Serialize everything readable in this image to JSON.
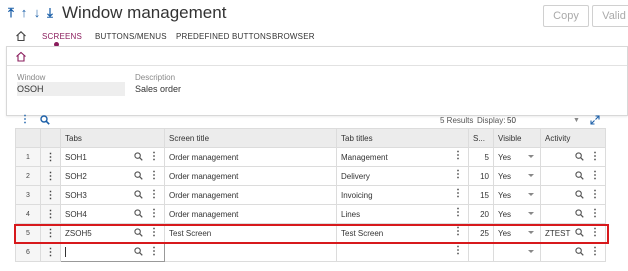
{
  "header": {
    "title": "Window management",
    "buttons": {
      "copy": "Copy",
      "valid": "Valid"
    }
  },
  "tabs": [
    {
      "label": "SCREENS",
      "active": true
    },
    {
      "label": "BUTTONS/MENUS",
      "active": false
    },
    {
      "label": "PREDEFINED BUTTONS",
      "active": false
    },
    {
      "label": "BROWSER",
      "active": false
    }
  ],
  "form": {
    "window_label": "Window",
    "window_value": "OSOH",
    "description_label": "Description",
    "description_value": "Sales order"
  },
  "grid_tools": {
    "results": "5 Results",
    "display_label": "Display:",
    "display_value": "50"
  },
  "grid": {
    "columns": [
      "Tabs",
      "Screen title",
      "Tab titles",
      "S...",
      "Visible",
      "Activity"
    ],
    "rows": [
      {
        "n": "1",
        "tab": "SOH1",
        "screen_title": "Order management",
        "tab_title": "Management",
        "s": "5",
        "visible": "Yes",
        "activity": ""
      },
      {
        "n": "2",
        "tab": "SOH2",
        "screen_title": "Order management",
        "tab_title": "Delivery",
        "s": "10",
        "visible": "Yes",
        "activity": ""
      },
      {
        "n": "3",
        "tab": "SOH3",
        "screen_title": "Order management",
        "tab_title": "Invoicing",
        "s": "15",
        "visible": "Yes",
        "activity": ""
      },
      {
        "n": "4",
        "tab": "SOH4",
        "screen_title": "Order management",
        "tab_title": "Lines",
        "s": "20",
        "visible": "Yes",
        "activity": ""
      },
      {
        "n": "5",
        "tab": "ZSOH5",
        "screen_title": "Test Screen",
        "tab_title": "Test Screen",
        "s": "25",
        "visible": "Yes",
        "activity": "ZTEST"
      },
      {
        "n": "6",
        "tab": "",
        "screen_title": "",
        "tab_title": "",
        "s": "",
        "visible": "",
        "activity": ""
      }
    ]
  },
  "colors": {
    "accent": "#8a1c5c",
    "nav_blue": "#1b5fa8",
    "highlight": "#d7191c"
  },
  "icons": [
    "arrow-first-icon",
    "arrow-up-icon",
    "arrow-down-icon",
    "arrow-last-icon",
    "home-icon",
    "search-icon",
    "more-vertical-icon",
    "expand-icon",
    "chevron-down-icon"
  ]
}
